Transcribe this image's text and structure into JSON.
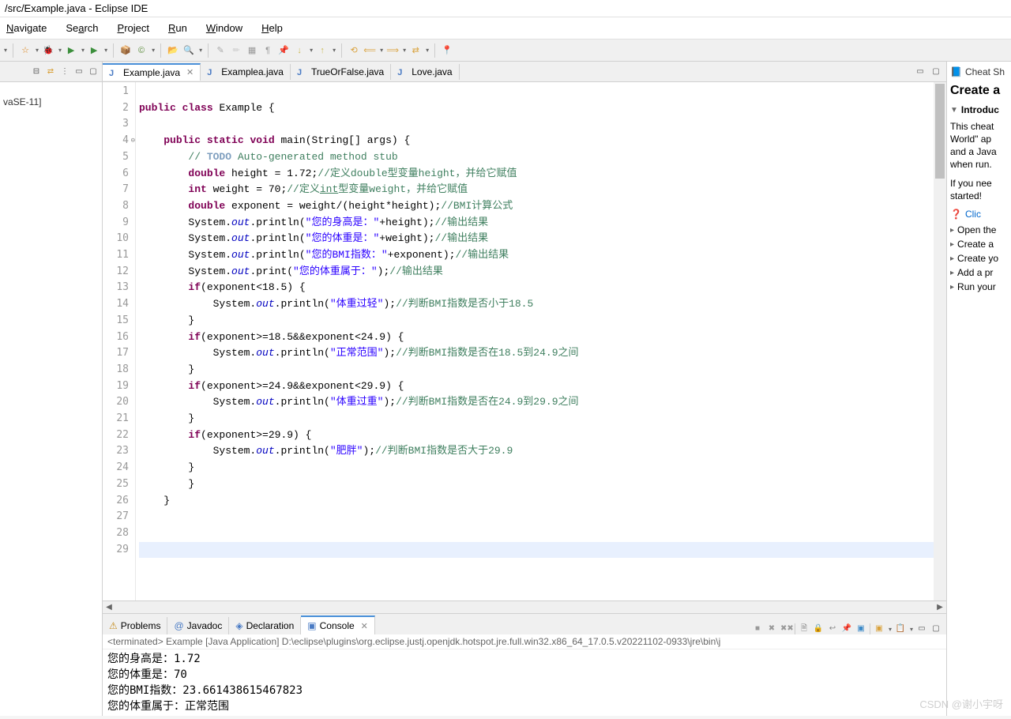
{
  "title": "/src/Example.java - Eclipse IDE",
  "menu": [
    "Navigate",
    "Search",
    "Project",
    "Run",
    "Window",
    "Help"
  ],
  "menu_accel": [
    "N",
    "Se",
    "P",
    "R",
    "W",
    "H"
  ],
  "left": {
    "entry": "vaSE-11]"
  },
  "tabs": [
    {
      "label": "Example.java",
      "active": true,
      "closable": true
    },
    {
      "label": "Examplea.java",
      "active": false,
      "closable": false
    },
    {
      "label": "TrueOrFalse.java",
      "active": false,
      "closable": false
    },
    {
      "label": "Love.java",
      "active": false,
      "closable": false
    }
  ],
  "lines": 29,
  "bottom_tabs": [
    {
      "icon": "⚠",
      "label": "Problems"
    },
    {
      "icon": "@",
      "label": "Javadoc"
    },
    {
      "icon": "📋",
      "label": "Declaration"
    },
    {
      "icon": "▣",
      "label": "Console",
      "active": true,
      "closable": true
    }
  ],
  "console_header": "<terminated> Example [Java Application] D:\\eclipse\\plugins\\org.eclipse.justj.openjdk.hotspot.jre.full.win32.x86_64_17.0.5.v20221102-0933\\jre\\bin\\j",
  "console_lines": [
    "您的身高是：1.72",
    "您的体重是：70",
    "您的BMI指数：23.661438615467823",
    "您的体重属于：正常范围"
  ],
  "cheat": {
    "title": "Cheat Sh",
    "heading": "Create a",
    "section": "Introduc",
    "text1": "This cheat",
    "text2": "World\" ap",
    "text3": "and a Java",
    "text4": "when run.",
    "text5": "If you nee",
    "text6": "started!",
    "link": "Clic",
    "items": [
      "Open the",
      "Create a",
      "Create yo",
      "Add a pr",
      "Run your"
    ]
  },
  "watermark": "CSDN @谢小宇呀"
}
